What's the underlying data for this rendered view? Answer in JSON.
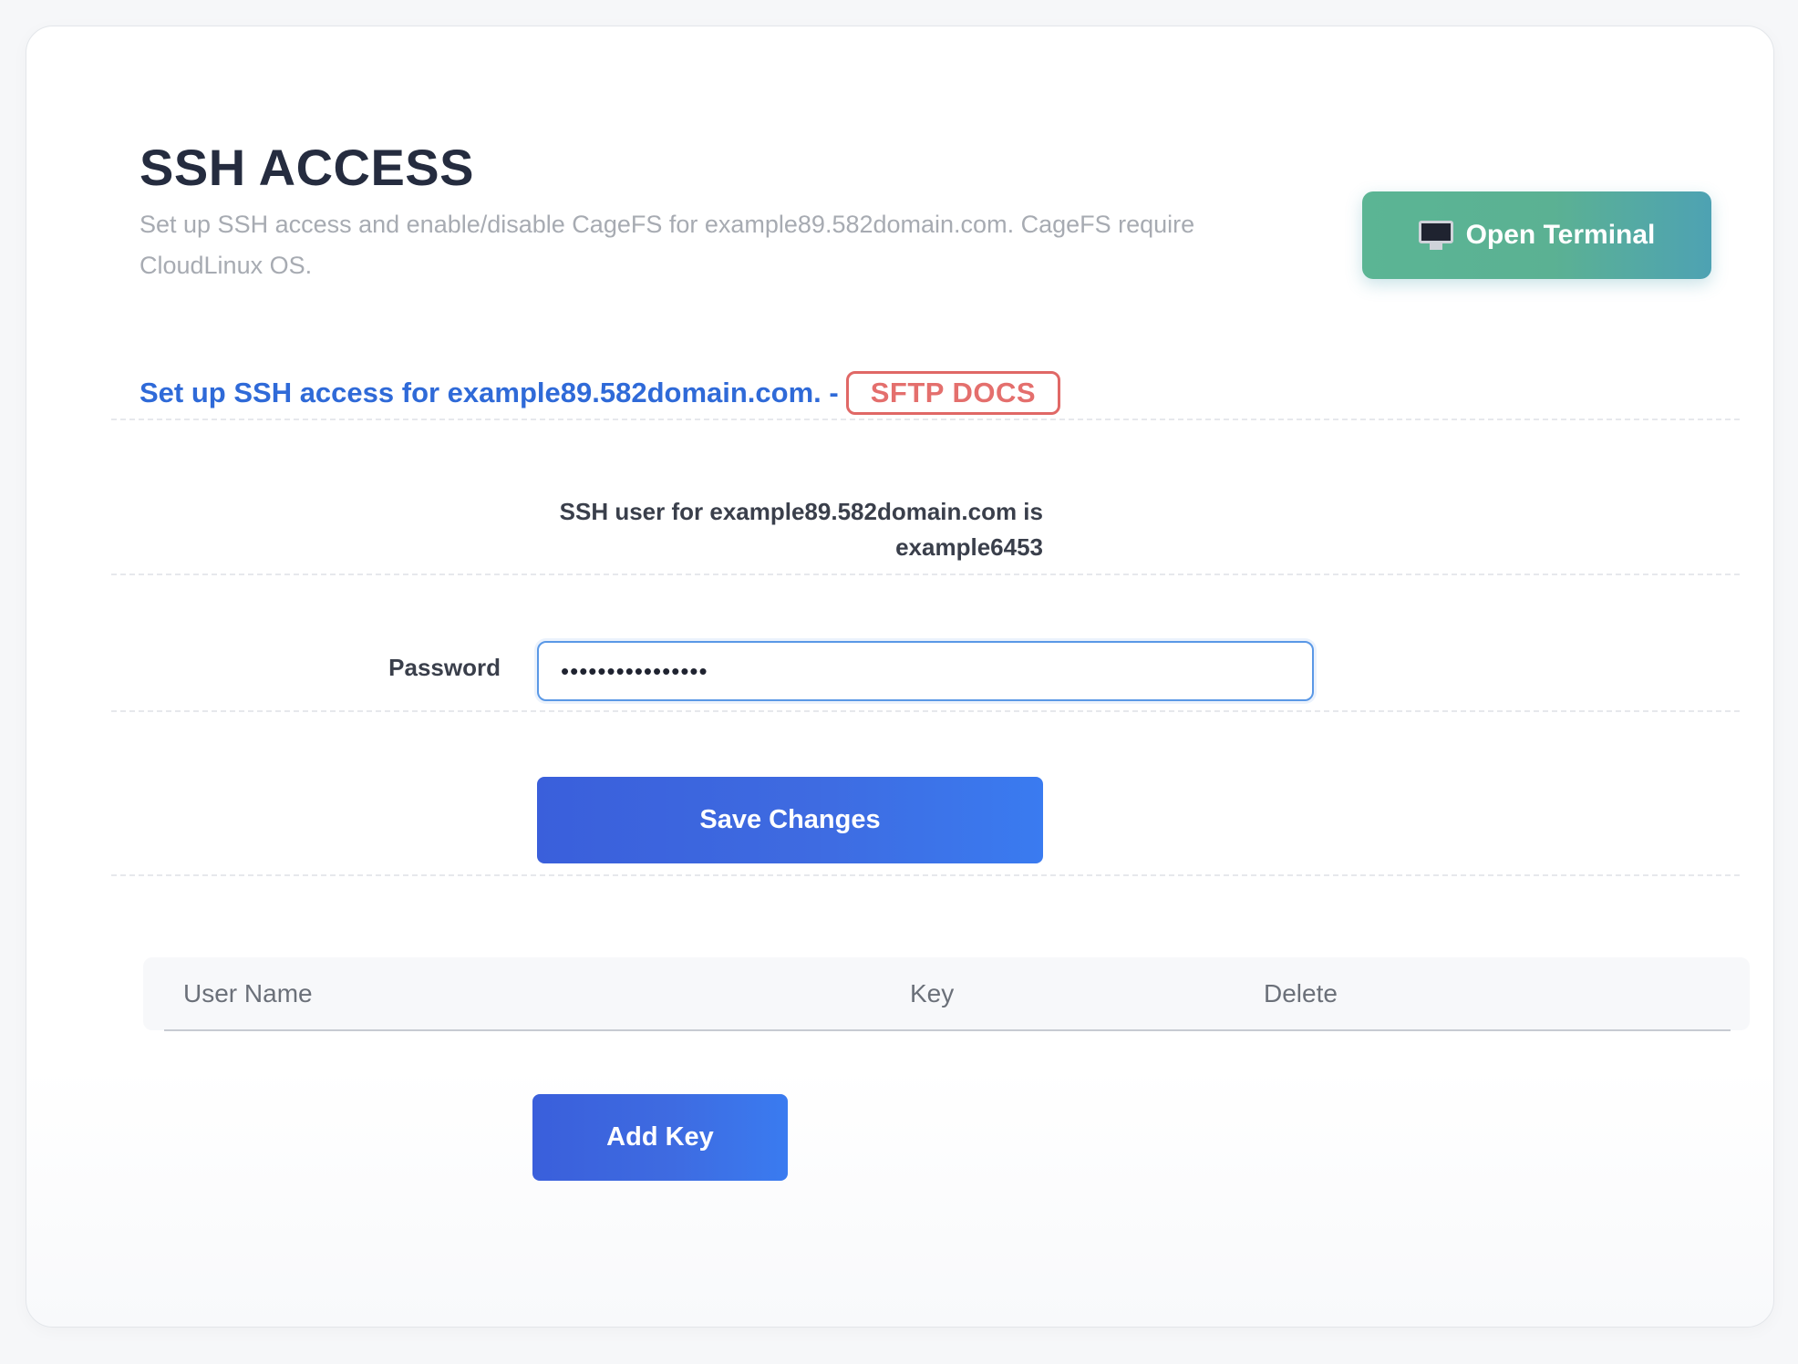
{
  "header": {
    "title": "SSH ACCESS",
    "subtitle": "Set up SSH access and enable/disable CageFS for example89.582domain.com. CageFS require CloudLinux OS.",
    "terminal_button_label": "Open Terminal",
    "terminal_button_icon": "monitor-icon"
  },
  "setup": {
    "text": "Set up SSH access for example89.582domain.com. -",
    "docs_label": "SFTP DOCS"
  },
  "ssh_user": {
    "line1": "SSH user for example89.582domain.com is",
    "line2": "example6453"
  },
  "password": {
    "label": "Password",
    "value": "••••••••••••••••"
  },
  "actions": {
    "save_label": "Save Changes",
    "add_key_label": "Add Key"
  },
  "keys_table": {
    "columns": [
      "User Name",
      "Key",
      "Delete"
    ],
    "rows": []
  },
  "colors": {
    "title": "#252c3f",
    "link_blue": "#2f6ad8",
    "docs_red": "#e46f6d",
    "terminal_green": "#5bb594",
    "primary_blue": "#3e6be1"
  }
}
